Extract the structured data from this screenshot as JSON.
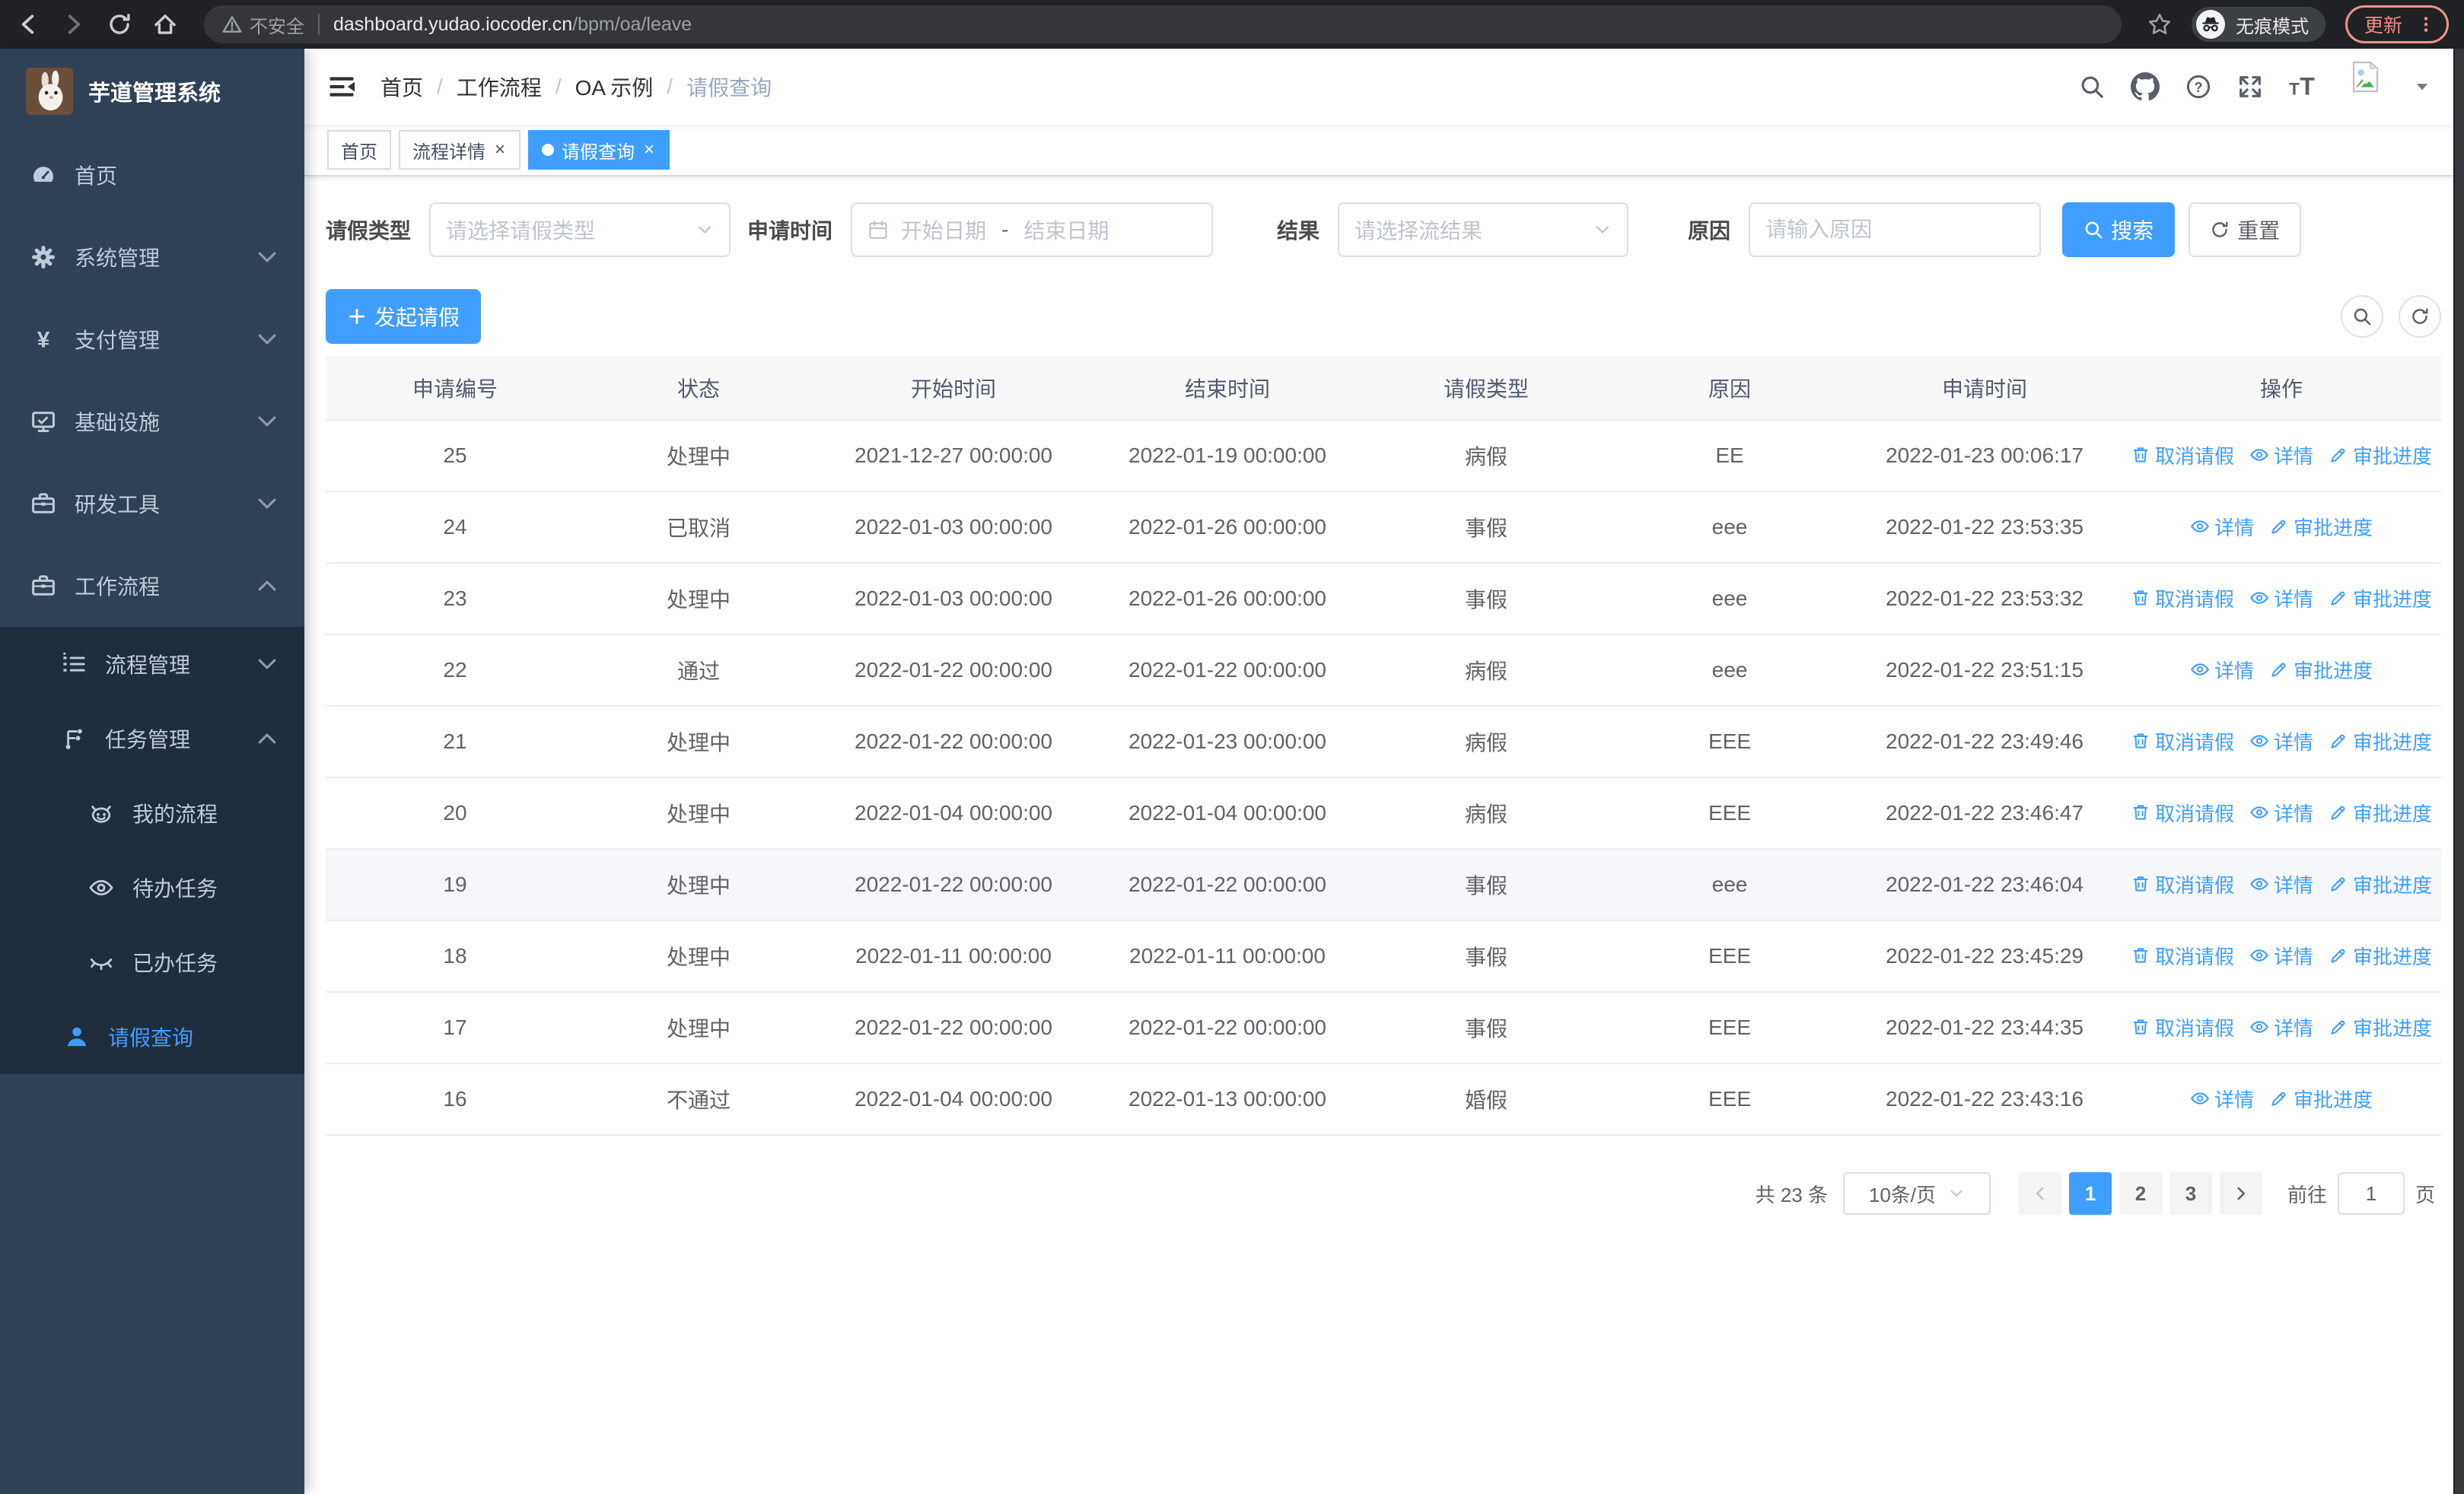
{
  "browser": {
    "security_label": "不安全",
    "url_domain": "dashboard.yudao.iocoder.cn",
    "url_path": "/bpm/oa/leave",
    "incognito_label": "无痕模式",
    "update_label": "更新"
  },
  "sidebar": {
    "title": "芋道管理系统",
    "menu": [
      {
        "label": "首页",
        "icon": "dashboard-icon",
        "level": 1
      },
      {
        "label": "系统管理",
        "icon": "gear-icon",
        "level": 1,
        "chevron": "down"
      },
      {
        "label": "支付管理",
        "icon": "yen-icon",
        "level": 1,
        "chevron": "down"
      },
      {
        "label": "基础设施",
        "icon": "monitor-icon",
        "level": 1,
        "chevron": "down"
      },
      {
        "label": "研发工具",
        "icon": "toolbox-icon",
        "level": 1,
        "chevron": "down"
      },
      {
        "label": "工作流程",
        "icon": "toolbox-icon",
        "level": 1,
        "chevron": "up"
      },
      {
        "label": "流程管理",
        "icon": "list-icon",
        "level": 2,
        "chevron": "down",
        "sub": true
      },
      {
        "label": "任务管理",
        "icon": "flow-icon",
        "level": 2,
        "chevron": "up",
        "sub": true
      },
      {
        "label": "我的流程",
        "icon": "face-icon",
        "level": 3,
        "sub": true
      },
      {
        "label": "待办任务",
        "icon": "eye-icon",
        "level": 3,
        "sub": true
      },
      {
        "label": "已办任务",
        "icon": "eye-closed-icon",
        "level": 3,
        "sub": true
      },
      {
        "label": "请假查询",
        "icon": "user-icon",
        "level": 2,
        "sub": true,
        "active": true,
        "leaf": true
      }
    ]
  },
  "navbar": {
    "breadcrumb": [
      "首页",
      "工作流程",
      "OA 示例",
      "请假查询"
    ]
  },
  "tags": [
    {
      "label": "首页"
    },
    {
      "label": "流程详情",
      "closable": true
    },
    {
      "label": "请假查询",
      "closable": true,
      "active": true
    }
  ],
  "filters": {
    "leave_type_label": "请假类型",
    "leave_type_placeholder": "请选择请假类型",
    "apply_time_label": "申请时间",
    "start_date_placeholder": "开始日期",
    "range_separator": "-",
    "end_date_placeholder": "结束日期",
    "result_label": "结果",
    "result_placeholder": "请选择流结果",
    "reason_label": "原因",
    "reason_placeholder": "请输入原因",
    "search_label": "搜索",
    "reset_label": "重置"
  },
  "toolbar": {
    "create_label": "发起请假"
  },
  "actions": {
    "cancel": "取消请假",
    "detail": "详情",
    "progress": "审批进度"
  },
  "table": {
    "columns": [
      "申请编号",
      "状态",
      "开始时间",
      "结束时间",
      "请假类型",
      "原因",
      "申请时间",
      "操作"
    ],
    "rows": [
      {
        "id": "25",
        "status": "处理中",
        "start_time": "2021-12-27 00:00:00",
        "end_time": "2022-01-19 00:00:00",
        "leave_type": "病假",
        "reason": "EE",
        "apply_time": "2022-01-23 00:06:17",
        "actions": [
          "cancel",
          "detail",
          "progress"
        ]
      },
      {
        "id": "24",
        "status": "已取消",
        "start_time": "2022-01-03 00:00:00",
        "end_time": "2022-01-26 00:00:00",
        "leave_type": "事假",
        "reason": "eee",
        "apply_time": "2022-01-22 23:53:35",
        "actions": [
          "detail",
          "progress"
        ]
      },
      {
        "id": "23",
        "status": "处理中",
        "start_time": "2022-01-03 00:00:00",
        "end_time": "2022-01-26 00:00:00",
        "leave_type": "事假",
        "reason": "eee",
        "apply_time": "2022-01-22 23:53:32",
        "actions": [
          "cancel",
          "detail",
          "progress"
        ]
      },
      {
        "id": "22",
        "status": "通过",
        "start_time": "2022-01-22 00:00:00",
        "end_time": "2022-01-22 00:00:00",
        "leave_type": "病假",
        "reason": "eee",
        "apply_time": "2022-01-22 23:51:15",
        "actions": [
          "detail",
          "progress"
        ]
      },
      {
        "id": "21",
        "status": "处理中",
        "start_time": "2022-01-22 00:00:00",
        "end_time": "2022-01-23 00:00:00",
        "leave_type": "病假",
        "reason": "EEE",
        "apply_time": "2022-01-22 23:49:46",
        "actions": [
          "cancel",
          "detail",
          "progress"
        ]
      },
      {
        "id": "20",
        "status": "处理中",
        "start_time": "2022-01-04 00:00:00",
        "end_time": "2022-01-04 00:00:00",
        "leave_type": "病假",
        "reason": "EEE",
        "apply_time": "2022-01-22 23:46:47",
        "actions": [
          "cancel",
          "detail",
          "progress"
        ]
      },
      {
        "id": "19",
        "status": "处理中",
        "start_time": "2022-01-22 00:00:00",
        "end_time": "2022-01-22 00:00:00",
        "leave_type": "事假",
        "reason": "eee",
        "apply_time": "2022-01-22 23:46:04",
        "actions": [
          "cancel",
          "detail",
          "progress"
        ],
        "highlighted": true
      },
      {
        "id": "18",
        "status": "处理中",
        "start_time": "2022-01-11 00:00:00",
        "end_time": "2022-01-11 00:00:00",
        "leave_type": "事假",
        "reason": "EEE",
        "apply_time": "2022-01-22 23:45:29",
        "actions": [
          "cancel",
          "detail",
          "progress"
        ]
      },
      {
        "id": "17",
        "status": "处理中",
        "start_time": "2022-01-22 00:00:00",
        "end_time": "2022-01-22 00:00:00",
        "leave_type": "事假",
        "reason": "EEE",
        "apply_time": "2022-01-22 23:44:35",
        "actions": [
          "cancel",
          "detail",
          "progress"
        ]
      },
      {
        "id": "16",
        "status": "不通过",
        "start_time": "2022-01-04 00:00:00",
        "end_time": "2022-01-13 00:00:00",
        "leave_type": "婚假",
        "reason": "EEE",
        "apply_time": "2022-01-22 23:43:16",
        "actions": [
          "detail",
          "progress"
        ]
      }
    ]
  },
  "pagination": {
    "total_label": "共 23 条",
    "page_size": "10条/页",
    "pages": [
      "1",
      "2",
      "3"
    ],
    "active_page": "1",
    "goto_label": "前往",
    "goto_value": "1",
    "goto_suffix": "页"
  },
  "colors": {
    "accent": "#409eff",
    "sidebar_bg": "#304156",
    "submenu_bg": "#1f2d3d",
    "chrome_bg": "#202124"
  }
}
